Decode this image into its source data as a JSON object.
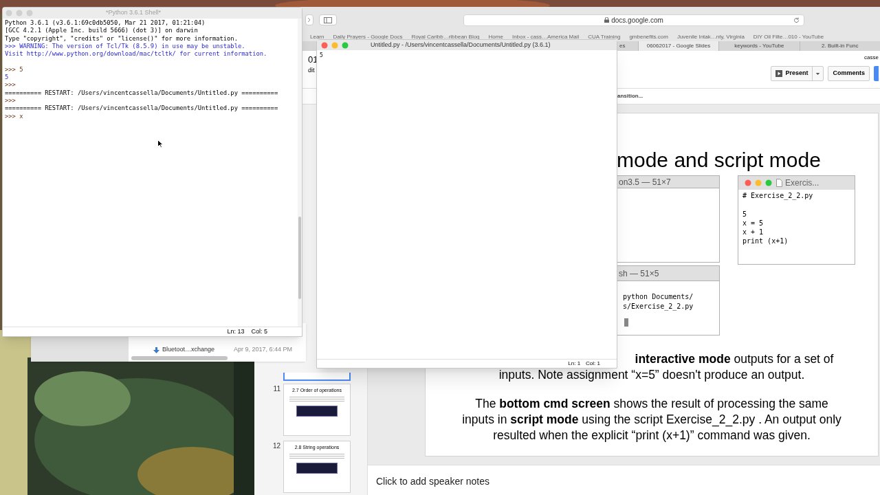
{
  "browser": {
    "url": "docs.google.com",
    "bookmarks": [
      "Learn",
      "Daily Prayers - Google Docs",
      "Royal Caribb…ribbean Blog",
      "Home",
      "Inbox - cass…America Mail",
      "CUA Training",
      "gmbenefits.com",
      "Juvenile Intak…nty, Virginia",
      "DIY Oil Filte…010 - YouTube"
    ],
    "tabs": [
      {
        "label": "es",
        "selected": false
      },
      {
        "label": "06062017 - Google Slides",
        "selected": true
      },
      {
        "label": "keywords - YouTube",
        "selected": false
      },
      {
        "label": "2. Built-in Func",
        "selected": false
      }
    ],
    "account": "casse",
    "present": "Present",
    "comments": "Comments",
    "transition": "ansition...",
    "doc_fragments": [
      "01",
      "dit"
    ]
  },
  "slides_panel": [
    {
      "selected": true
    },
    {
      "number": "11",
      "title": "2.7 Order of operations",
      "selected": false
    },
    {
      "number": "12",
      "title": "2.8 String operations",
      "selected": false
    }
  ],
  "slide": {
    "title": "mode and script mode",
    "terminal_top": {
      "title": "on3.5 — 51×7"
    },
    "terminal_bottom": {
      "title": "sh — 51×5",
      "lines": [
        "python Documents/",
        "s/Exercise_2_2.py"
      ]
    },
    "editor": {
      "title": "Exercis...",
      "lines": [
        {
          "kind": "code",
          "text": "# Exercise_2_2.py"
        },
        {
          "kind": "blank"
        },
        {
          "kind": "code",
          "text": "5"
        },
        {
          "kind": "code",
          "text": "x = 5"
        },
        {
          "kind": "code",
          "text": "x + 1"
        },
        {
          "kind": "code",
          "text": "print (x+1)"
        }
      ]
    },
    "paragraph_1": [
      "**interactive mode** outputs for a set of",
      "inputs. Note assignment “x=5” doesn't produce an output."
    ],
    "paragraph_2": "The **bottom cmd screen** shows the result of processing the same inputs in **script mode** using the script Exercise_2_2.py . An output only resulted when the explicit “print (x+1)” command was given."
  },
  "speaker_notes": {
    "placeholder": "Click to add speaker notes"
  },
  "finder_window": {
    "rows": [
      {
        "name": "Bluetoot…xchange",
        "date": "Apr 9, 2017, 6:44 PM"
      }
    ]
  },
  "shell_window": {
    "title": "*Python 3.6.1 Shell*",
    "lines": [
      {
        "kind": "info",
        "text": "Python 3.6.1 (v3.6.1:69c0db5050, Mar 21 2017, 01:21:04)"
      },
      {
        "kind": "info",
        "text": "[GCC 4.2.1 (Apple Inc. build 5666) (dot 3)] on darwin"
      },
      {
        "kind": "info",
        "text": "Type \"copyright\", \"credits\" or \"license()\" for more information."
      },
      {
        "kind": "warning",
        "text": ">>> WARNING: The version of Tcl/Tk (8.5.9) in use may be unstable."
      },
      {
        "kind": "warning",
        "text": "Visit http://www.python.org/download/mac/tcltk/ for current information."
      },
      {
        "kind": "blank"
      },
      {
        "kind": "prompt",
        "text": ">>> 5"
      },
      {
        "kind": "output",
        "text": "5"
      },
      {
        "kind": "prompt",
        "text": ">>>"
      },
      {
        "kind": "info",
        "text": "========== RESTART: /Users/vincentcassella/Documents/Untitled.py =========="
      },
      {
        "kind": "prompt",
        "text": ">>>"
      },
      {
        "kind": "info",
        "text": "========== RESTART: /Users/vincentcassella/Documents/Untitled.py =========="
      },
      {
        "kind": "prompt",
        "text": ">>> x"
      }
    ],
    "line": "Ln: 13",
    "col": "Col: 5"
  },
  "editor_window": {
    "title": "Untitled.py - /Users/vincentcassella/Documents/Untitled.py (3.6.1)",
    "lines": [
      "5"
    ],
    "line": "Ln: 1",
    "col": "Col: 1"
  }
}
